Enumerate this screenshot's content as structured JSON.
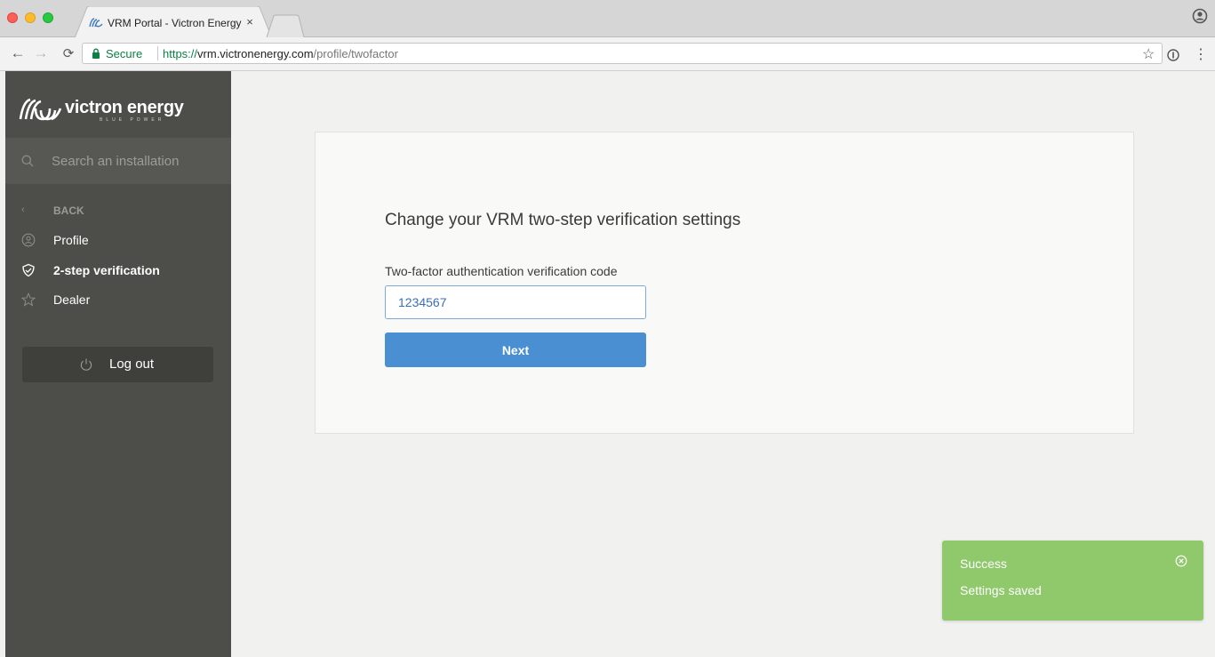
{
  "browser": {
    "tab_title": "VRM Portal - Victron Energy",
    "tab_close": "×",
    "secure_label": "Secure",
    "url_scheme": "https://",
    "url_host": "vrm.victronenergy.com",
    "url_path": "/profile/twofactor",
    "icons": [
      "back-arrow-icon",
      "forward-arrow-icon",
      "reload-icon",
      "lock-icon",
      "star-icon",
      "extension-icon",
      "menu-icon",
      "profile-icon"
    ]
  },
  "sidebar": {
    "brand": "victron energy",
    "brand_tagline": "BLUE POWER",
    "search_placeholder": "Search an installation",
    "back_label": "BACK",
    "items": [
      {
        "label": "Profile",
        "icon": "profile-icon"
      },
      {
        "label": "2-step verification",
        "icon": "shield-icon",
        "active": true
      },
      {
        "label": "Dealer",
        "icon": "star-icon"
      }
    ],
    "logout_label": "Log out"
  },
  "main": {
    "title": "Change your VRM two-step verification settings",
    "field_label": "Two-factor authentication verification code",
    "field_value": "1234567",
    "submit_label": "Next"
  },
  "toast": {
    "title": "Success",
    "message": "Settings saved",
    "color": "#8fc96c"
  },
  "colors": {
    "sidebar_bg": "#4d4d49",
    "accent": "#4a8fd2",
    "success": "#8fc96c"
  }
}
